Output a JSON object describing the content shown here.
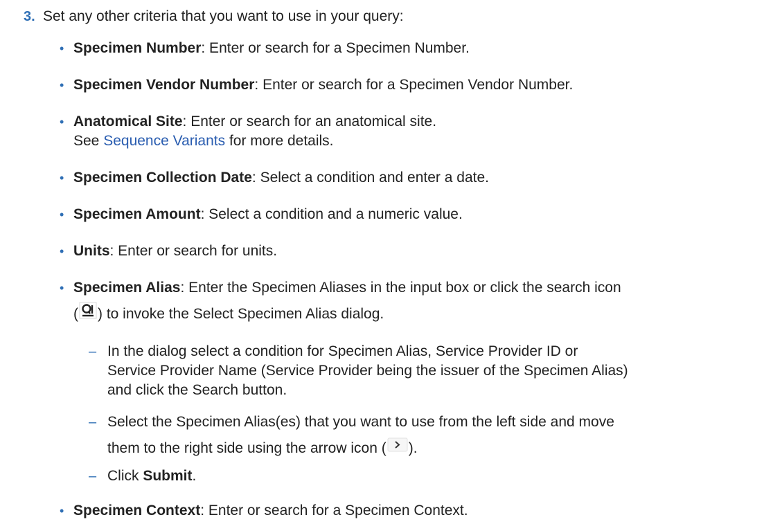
{
  "step": {
    "number": "3.",
    "text": "Set any other criteria that you want to use in your query:"
  },
  "bullets": [
    {
      "label": "Specimen Number",
      "text": ": Enter or search for a Specimen Number."
    },
    {
      "label": "Specimen Vendor Number",
      "text": ": Enter or search for a Specimen Vendor Number."
    },
    {
      "label": "Anatomical Site",
      "text": ": Enter or search for an anatomical site.",
      "line2_pre": "See ",
      "line2_link": "Sequence Variants",
      "line2_post": " for more details."
    },
    {
      "label": "Specimen Collection Date",
      "text": ": Select a condition and enter a date."
    },
    {
      "label": "Specimen Amount",
      "text": ": Select a condition and a numeric value."
    },
    {
      "label": "Units",
      "text": ": Enter or search for units."
    },
    {
      "label": "Specimen Alias",
      "text": ": Enter the Specimen Aliases in the input box or click the search icon",
      "line2_pre": "(",
      "line2_post": ") to invoke the Select Specimen Alias dialog."
    },
    {
      "label": "Specimen Context",
      "text": ": Enter or search for a Specimen Context."
    }
  ],
  "subitems": [
    {
      "line1": "In the dialog select a condition for Specimen Alias, Service Provider ID or",
      "line2": "Service Provider Name (Service Provider being the issuer of the Specimen Alias)",
      "line3": "and click the Search button."
    },
    {
      "line1": "Select the Specimen Alias(es) that you want to use from the left side and move",
      "line2_pre": "them to the right side using the arrow icon (",
      "line2_post": ")."
    },
    {
      "pre": "Click ",
      "bold": "Submit",
      "post": "."
    }
  ],
  "symbols": {
    "bullet": "•",
    "dash": "–"
  },
  "icons": {
    "search": "search-icon",
    "arrow": "arrow-right-icon"
  },
  "colors": {
    "accent": "#2f6fb5",
    "link": "#2a5db0",
    "text": "#222222"
  }
}
